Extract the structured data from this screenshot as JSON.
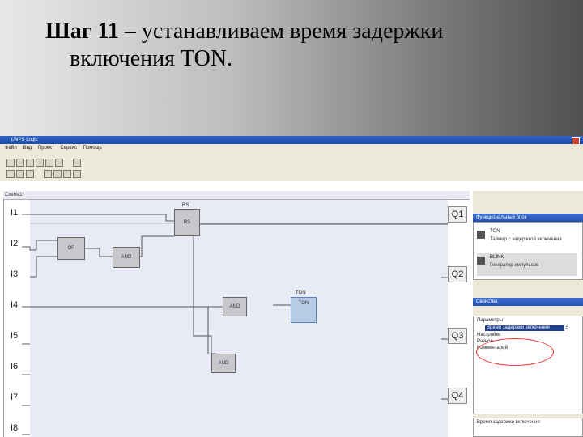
{
  "slide": {
    "title_bold": "Шаг 11",
    "title_rest": " – устанавливаем время задержки",
    "title_line2": "включения TON."
  },
  "app": {
    "window_title": "LWPS Logic",
    "menu": [
      "Файл",
      "Вид",
      "Проект",
      "Сервис",
      "Помощь"
    ],
    "canvas_tab": "Схема1*"
  },
  "canvas": {
    "inputs": [
      "I1",
      "I2",
      "I3",
      "I4",
      "I5",
      "I6",
      "I7",
      "I8"
    ],
    "outputs": [
      "Q1",
      "Q2",
      "Q3",
      "Q4"
    ],
    "blocks": {
      "rs_label": "RS",
      "rs_block_label": "RS",
      "or_label": "OR",
      "and1_label": "AND",
      "and2_label": "AND",
      "and3_label": "AND",
      "ton_label": "TON",
      "ton_block_label": "TON"
    }
  },
  "side": {
    "fb_header": "Функциональный блок",
    "fb_items": [
      {
        "name": "TON",
        "desc": "Таймер с задержкой включения"
      },
      {
        "name": "BLINK",
        "desc": "Генератор импульсов"
      }
    ],
    "props_header": "Свойства",
    "props": [
      {
        "label": "Параметры"
      },
      {
        "label": "Время задержки включения",
        "value": "5"
      },
      {
        "label": "Настройки"
      },
      {
        "label": "Разное"
      },
      {
        "label": "Комментарий"
      }
    ],
    "help_title": "Время задержки включения"
  },
  "colors": {
    "accent": "#1b3f8c",
    "highlight": "#e33333"
  }
}
